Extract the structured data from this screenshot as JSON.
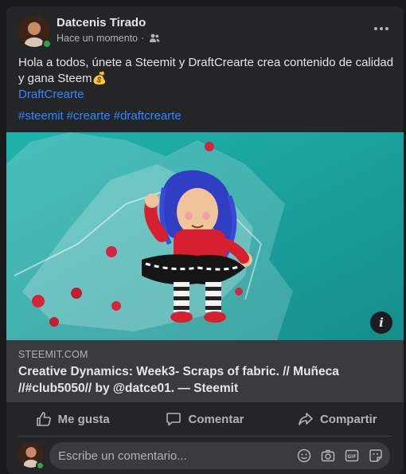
{
  "post": {
    "author": "Datcenis Tirado",
    "timestamp": "Hace un momento",
    "audience_separator": "·",
    "text_line": "Hola a todos, únete a Steemit y DraftCrearte crea contenido de calidad y gana Steem💰",
    "link_text": "DraftCrearte",
    "hashtags": [
      "#steemit",
      "#crearte",
      "#draftcrearte"
    ],
    "image_icon": "info-icon",
    "image_icon_text": "i"
  },
  "link_preview": {
    "domain": "STEEMIT.COM",
    "title": "Creative Dynamics: Week3- Scraps of fabric. // Muñeca //#club5050// by @datce01. — Steemit"
  },
  "actions": {
    "like": "Me gusta",
    "comment": "Comentar",
    "share": "Compartir"
  },
  "comment_box": {
    "placeholder": "Escribe un comentario...",
    "icons": [
      "emoji-icon",
      "camera-icon",
      "gif-icon",
      "sticker-icon"
    ]
  },
  "colors": {
    "background": "#18191a",
    "card": "#242526",
    "link": "#2d88ff",
    "online": "#31a24c"
  }
}
